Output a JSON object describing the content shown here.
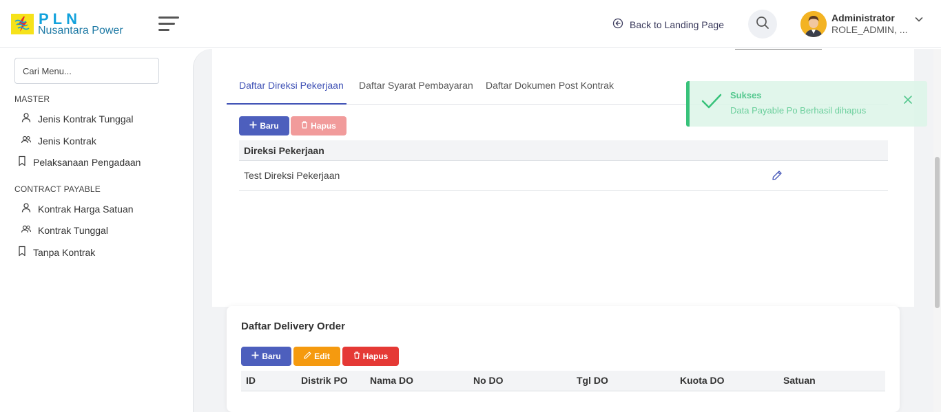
{
  "header": {
    "logo_line1": "PLN",
    "logo_line2": "Nusantara Power",
    "back_link": "Back to Landing Page",
    "user_name": "Administrator",
    "user_role": "ROLE_ADMIN, ..."
  },
  "sidebar": {
    "search_placeholder": "Cari Menu...",
    "sections": [
      {
        "title": "MASTER",
        "items": [
          {
            "label": "Jenis Kontrak Tunggal",
            "icon": "user-icon"
          },
          {
            "label": "Jenis Kontrak",
            "icon": "users-icon"
          },
          {
            "label": "Pelaksanaan Pengadaan",
            "icon": "bookmark-icon"
          }
        ]
      },
      {
        "title": "CONTRACT PAYABLE",
        "items": [
          {
            "label": "Kontrak Harga Satuan",
            "icon": "user-icon"
          },
          {
            "label": "Kontrak Tunggal",
            "icon": "users-icon"
          },
          {
            "label": "Tanpa Kontrak",
            "icon": "bookmark-icon"
          }
        ]
      }
    ]
  },
  "main": {
    "tabs": [
      {
        "label": "Daftar Direksi Pekerjaan",
        "active": true
      },
      {
        "label": "Daftar Syarat Pembayaran",
        "active": false
      },
      {
        "label": "Daftar Dokumen Post Kontrak",
        "active": false
      }
    ],
    "direksi": {
      "btn_new": "Baru",
      "btn_delete": "Hapus",
      "column": "Direksi Pekerjaan",
      "rows": [
        "Test Direksi Pekerjaan"
      ]
    },
    "delivery_order": {
      "title": "Daftar Delivery Order",
      "btn_new": "Baru",
      "btn_edit": "Edit",
      "btn_delete": "Hapus",
      "columns": [
        "ID",
        "Distrik PO",
        "Nama DO",
        "No DO",
        "Tgl DO",
        "Kuota DO",
        "Satuan"
      ]
    }
  },
  "toast": {
    "title": "Sukses",
    "message": "Data Payable Po Berhasil dihapus"
  },
  "colors": {
    "primary": "#3f51b5",
    "success": "#37c27a",
    "warning": "#f59a0f",
    "danger": "#e53935"
  }
}
